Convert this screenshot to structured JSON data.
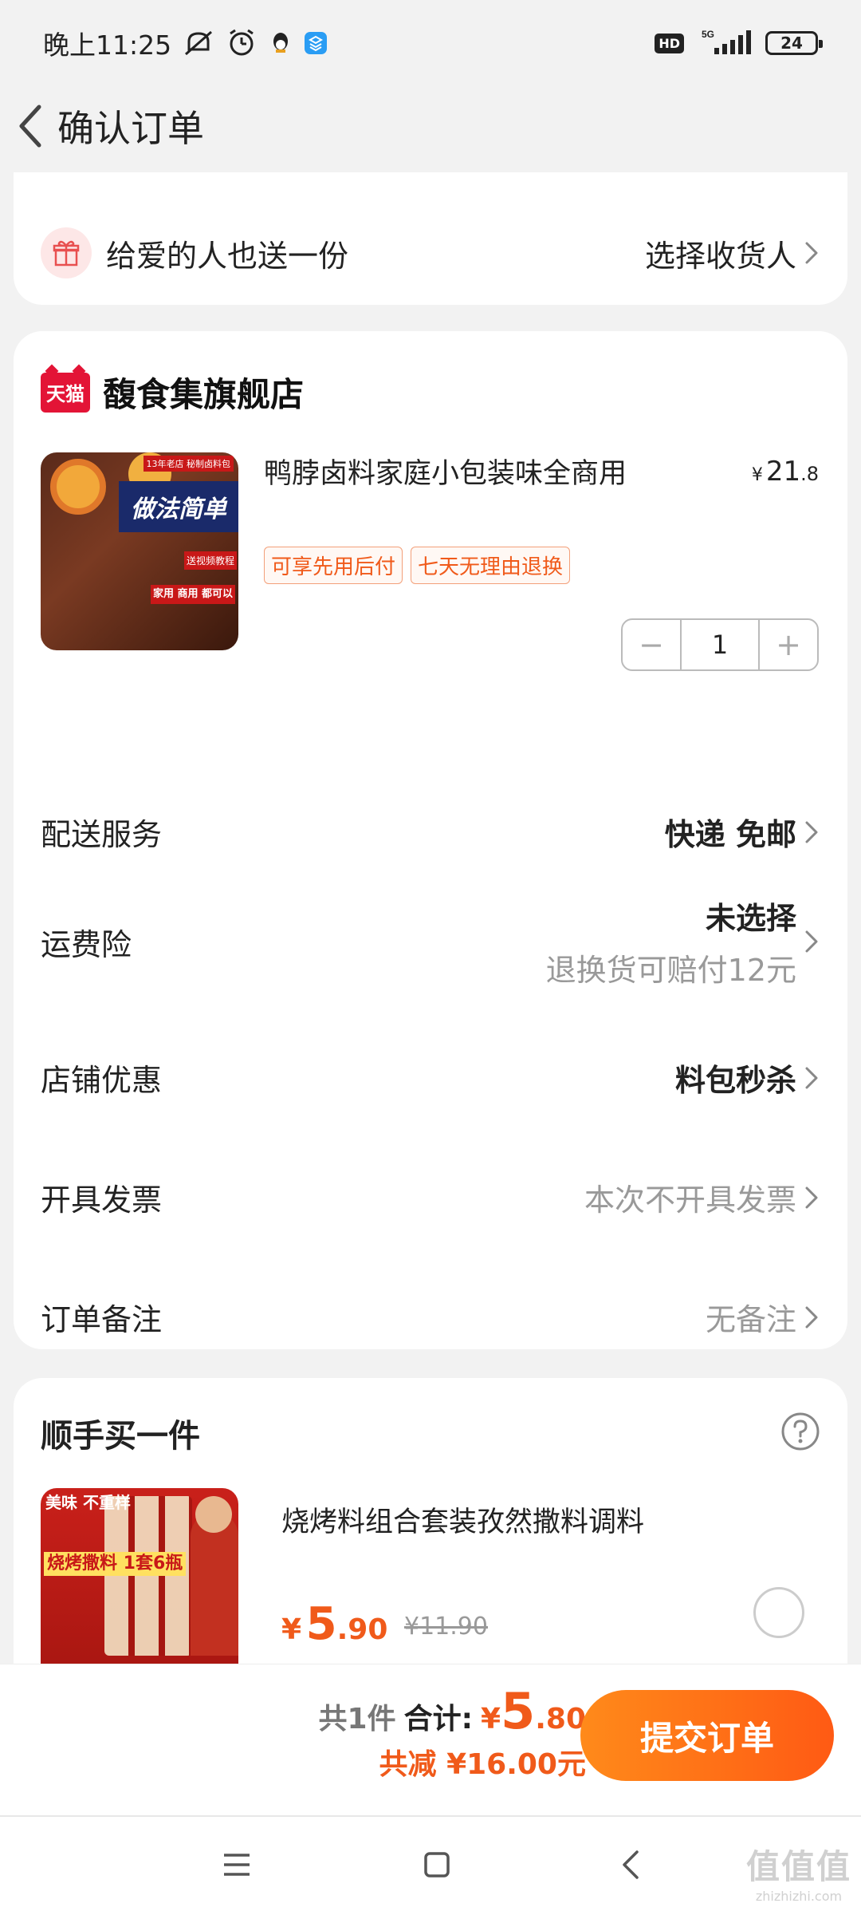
{
  "status_bar": {
    "time": "晚上11:25",
    "icons": [
      "mute-icon",
      "alarm-icon",
      "qq-icon",
      "app-icon"
    ],
    "network": "5G",
    "hd": "HD",
    "battery": "24"
  },
  "nav": {
    "title": "确认订单"
  },
  "gift": {
    "label": "给爱的人也送一份",
    "action": "选择收货人"
  },
  "order": {
    "shop_badge": "天猫",
    "shop_name": "馥食集旗舰店",
    "product": {
      "title": "鸭脖卤料家庭小包装味全商用",
      "price_currency": "¥",
      "price_int": "21",
      "price_dec": ".8",
      "image_banner": "做法简单",
      "image_tag_top": "13年老店 秘制卤料包",
      "image_tag_mid": "送视频教程",
      "image_tag_bottom": "家用 商用 都可以",
      "tags": [
        "可享先用后付",
        "七天无理由退换"
      ],
      "quantity": "1",
      "minus": "−",
      "plus": "+"
    },
    "rows": {
      "delivery": {
        "label": "配送服务",
        "value": "快递 免邮"
      },
      "insurance": {
        "label": "运费险",
        "value": "未选择",
        "sub": "退换货可赔付12元"
      },
      "discount": {
        "label": "店铺优惠",
        "value": "料包秒杀"
      },
      "invoice": {
        "label": "开具发票",
        "value": "本次不开具发票"
      },
      "note": {
        "label": "订单备注",
        "value": "无备注"
      }
    }
  },
  "upsell": {
    "title": "顺手买一件",
    "product_title": "烧烤料组合套装孜然撒料调料",
    "image_text_top": "美味 不重样",
    "image_text_mid": "烧烤撒料 1套6瓶",
    "price_currency": "¥",
    "price_int": "5",
    "price_dec": ".90",
    "old_price": "¥11.90"
  },
  "footer": {
    "count": "共1件",
    "sum_label": "合计:",
    "sum_currency": "¥",
    "sum_int": "5",
    "sum_dec": ".80",
    "saved": "共减 ¥16.00元",
    "submit": "提交订单"
  },
  "watermark": {
    "big": "值值值",
    "small": "zhizhizhi.com"
  },
  "colors": {
    "accent": "#f05a1a",
    "tmall_red": "#e31436",
    "submit_start": "#ff8a1a",
    "submit_end": "#ff5a14",
    "background": "#f2f2f2"
  }
}
